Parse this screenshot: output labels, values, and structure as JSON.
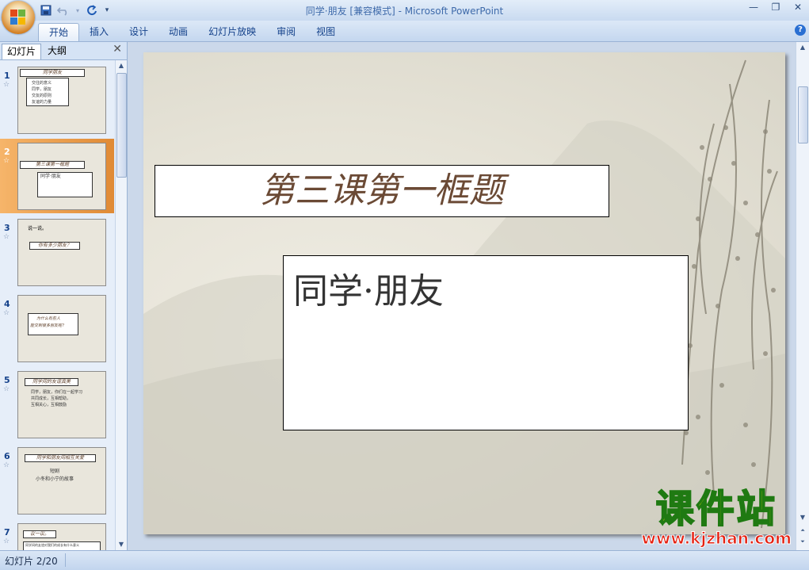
{
  "window": {
    "title": "同学·朋友 [兼容模式] - Microsoft PowerPoint",
    "controls": {
      "minimize": "—",
      "restore": "❐",
      "close": "✕"
    }
  },
  "quick_access": {
    "save_icon": "save-icon",
    "undo_icon": "undo-icon",
    "redo_icon": "redo-icon",
    "more": "▾"
  },
  "ribbon": {
    "tabs": [
      "开始",
      "插入",
      "设计",
      "动画",
      "幻灯片放映",
      "审阅",
      "视图"
    ],
    "active_tab": "开始",
    "help": "?"
  },
  "panel": {
    "tabs": [
      "幻灯片",
      "大纲"
    ],
    "close": "✕",
    "slides": [
      {
        "num": "1",
        "star": "☆",
        "title": "同学朋友",
        "lines": [
          "交往的意义",
          "同学，朋友",
          "交友的原则",
          "友谊的力量"
        ]
      },
      {
        "num": "2",
        "star": "☆",
        "title": "第三课第一框题",
        "lines": [
          "同学·朋友"
        ]
      },
      {
        "num": "3",
        "star": "☆",
        "title": "说一说。",
        "lines": [
          "你有多少朋友？"
        ]
      },
      {
        "num": "4",
        "star": "☆",
        "title": "为什么有些人",
        "lines": [
          "能交到很多朋友呢？"
        ]
      },
      {
        "num": "5",
        "star": "☆",
        "title": "同学间的友谊真美",
        "lines": [
          "同学，朋友，你们在一起学习",
          "共同成长，互相帮助，",
          "互相关心，互相鼓励"
        ]
      },
      {
        "num": "6",
        "star": "☆",
        "title": "同学和朋友间相互关爱",
        "lines": [
          "短剧",
          "小冬和小宁的故事"
        ]
      },
      {
        "num": "7",
        "star": "☆",
        "title": "议一议。",
        "lines": [
          "同学间的友谊对我们的成长有什么意义"
        ]
      }
    ],
    "selected_index": 1
  },
  "slide": {
    "title": "第三课第一框题",
    "body": "同学·朋友"
  },
  "watermark": {
    "text": "课件站",
    "url": "www.kjzhan.com"
  },
  "status": {
    "slide_indicator": "幻灯片 2/20"
  },
  "colors": {
    "accent": "#15428b",
    "selected_thumb": "#e08a35",
    "title_text": "#6b4a35"
  }
}
